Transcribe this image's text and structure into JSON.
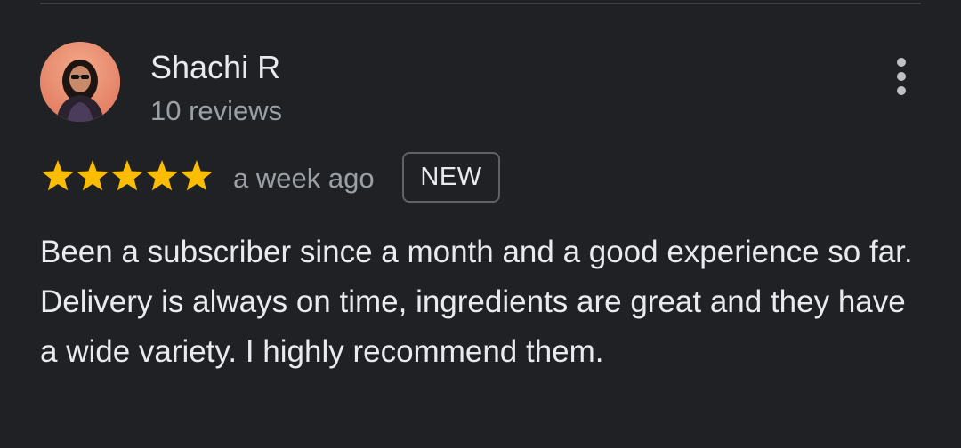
{
  "review": {
    "reviewer_name": "Shachi R",
    "review_count": "10 reviews",
    "rating": 5,
    "rating_max": 5,
    "time_ago": "a week ago",
    "badge": "NEW",
    "text": "Been a subscriber since a month and a good experience so far. Delivery is always on time, ingredients are great and they have a wide variety. I highly recommend them."
  },
  "icons": {
    "avatar": "profile-photo",
    "star": "star-icon",
    "more": "more-vert-icon"
  },
  "colors": {
    "background": "#202124",
    "star": "#fbbc04",
    "primary_text": "#e8eaed",
    "secondary_text": "#9aa0a6",
    "badge_border": "#5f6368",
    "divider": "#3c4043"
  }
}
